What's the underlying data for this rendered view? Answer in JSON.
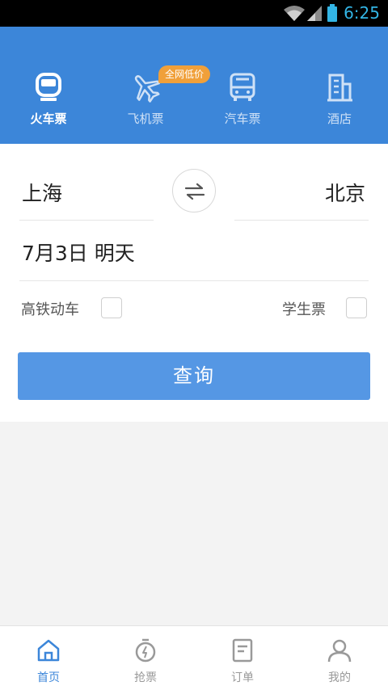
{
  "status_bar": {
    "time": "6:25",
    "icons": [
      "wifi-icon",
      "signal-icon",
      "battery-icon"
    ]
  },
  "categories": [
    {
      "label": "火车票",
      "icon": "train-icon",
      "active": true
    },
    {
      "label": "飞机票",
      "icon": "airplane-icon",
      "active": false
    },
    {
      "label": "汽车票",
      "icon": "bus-icon",
      "active": false
    },
    {
      "label": "酒店",
      "icon": "hotel-icon",
      "active": false
    }
  ],
  "promo_badge": "全网低价",
  "form": {
    "from_city": "上海",
    "to_city": "北京",
    "date": "7月3日  明天",
    "option_highspeed": "高铁动车",
    "option_student": "学生票",
    "search_label": "查询"
  },
  "bottom_nav": [
    {
      "label": "首页",
      "icon": "home-icon",
      "active": true
    },
    {
      "label": "抢票",
      "icon": "stopwatch-icon",
      "active": false
    },
    {
      "label": "订单",
      "icon": "order-icon",
      "active": false
    },
    {
      "label": "我的",
      "icon": "profile-icon",
      "active": false
    }
  ],
  "colors": {
    "primary": "#3c86d9",
    "button": "#5597e4",
    "badge": "#f0a03a",
    "status_accent": "#33b5e5"
  }
}
